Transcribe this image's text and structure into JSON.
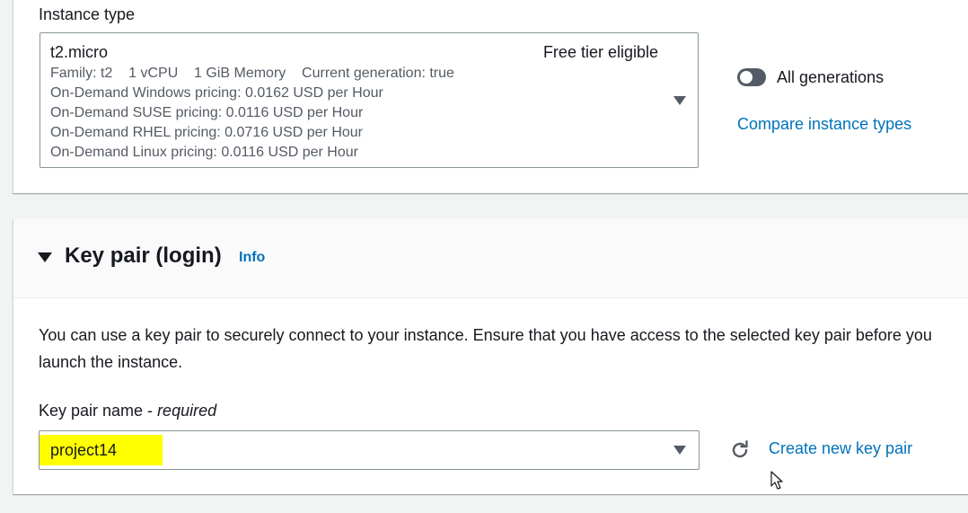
{
  "instance_type": {
    "label": "Instance type",
    "name": "t2.micro",
    "free_tier": "Free tier eligible",
    "details": [
      "Family: t2    1 vCPU    1 GiB Memory    Current generation: true",
      "On-Demand Windows pricing: 0.0162 USD per Hour",
      "On-Demand SUSE pricing: 0.0116 USD per Hour",
      "On-Demand RHEL pricing: 0.0716 USD per Hour",
      "On-Demand Linux pricing: 0.0116 USD per Hour"
    ],
    "all_generations_label": "All generations",
    "compare_link": "Compare instance types"
  },
  "key_pair": {
    "title": "Key pair (login)",
    "info": "Info",
    "description": "You can use a key pair to securely connect to your instance. Ensure that you have access to the selected key pair before you launch the instance.",
    "field_label": "Key pair name - ",
    "field_required": "required",
    "selected_value": "project14",
    "create_link": "Create new key pair"
  },
  "colors": {
    "link": "#0073bb",
    "highlight": "#ffff00",
    "toggle_off": "#545b64"
  },
  "icons": [
    "caret-down-icon",
    "refresh-icon",
    "cursor-icon",
    "toggle-switch"
  ]
}
